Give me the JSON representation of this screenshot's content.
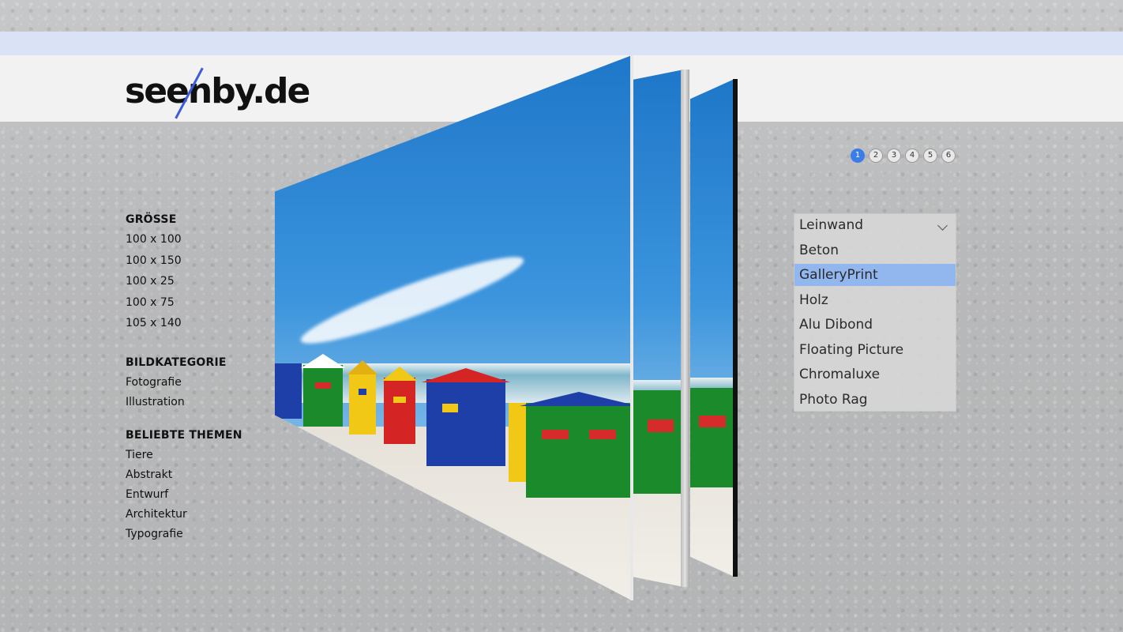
{
  "brand": {
    "logo_text": "seenby.de"
  },
  "pagination": {
    "pages": [
      "1",
      "2",
      "3",
      "4",
      "5",
      "6"
    ],
    "active": "1"
  },
  "sidebar": {
    "size": {
      "heading": "GRÖSSE",
      "items": [
        "100 x 100",
        "100 x 150",
        "100 x 25",
        "100 x 75",
        "105 x 140"
      ]
    },
    "category": {
      "heading": "BILDKATEGORIE",
      "items": [
        "Fotografie",
        "Illustration"
      ]
    },
    "themes": {
      "heading": "BELIEBTE THEMEN",
      "items": [
        "Tiere",
        "Abstrakt",
        "Entwurf",
        "Architektur",
        "Typografie"
      ]
    }
  },
  "material_dropdown": {
    "selected": "Leinwand",
    "options": [
      "Leinwand",
      "Beton",
      "GalleryPrint",
      "Holz",
      "Alu Dibond",
      "Floating Picture",
      "Chromaluxe",
      "Photo Rag"
    ],
    "highlighted": "GalleryPrint",
    "highlight_color": "#92b6ee"
  },
  "colors": {
    "accent": "#3b7de8",
    "header_band": "#d9e3f5"
  }
}
